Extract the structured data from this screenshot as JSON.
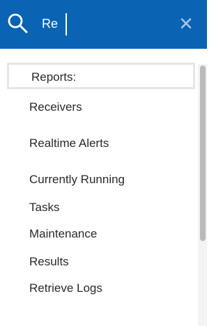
{
  "search": {
    "value": "Re",
    "clear_glyph": "✕",
    "icon": "search-icon"
  },
  "results": [
    {
      "lines": [
        "Reports:"
      ]
    },
    {
      "lines": [
        "Receivers"
      ]
    },
    {
      "lines": [
        "Realtime Alerts"
      ]
    },
    {
      "lines": [
        "Currently Running",
        "Tasks"
      ]
    },
    {
      "lines": [
        "Maintenance",
        "Results"
      ]
    },
    {
      "lines": [
        "Retrieve Logs"
      ]
    }
  ],
  "colors": {
    "header": "#0b63b4",
    "text": "#2a2a2a",
    "highlight_border": "#e6e6e6",
    "scroll_thumb": "#b9b9b9"
  }
}
